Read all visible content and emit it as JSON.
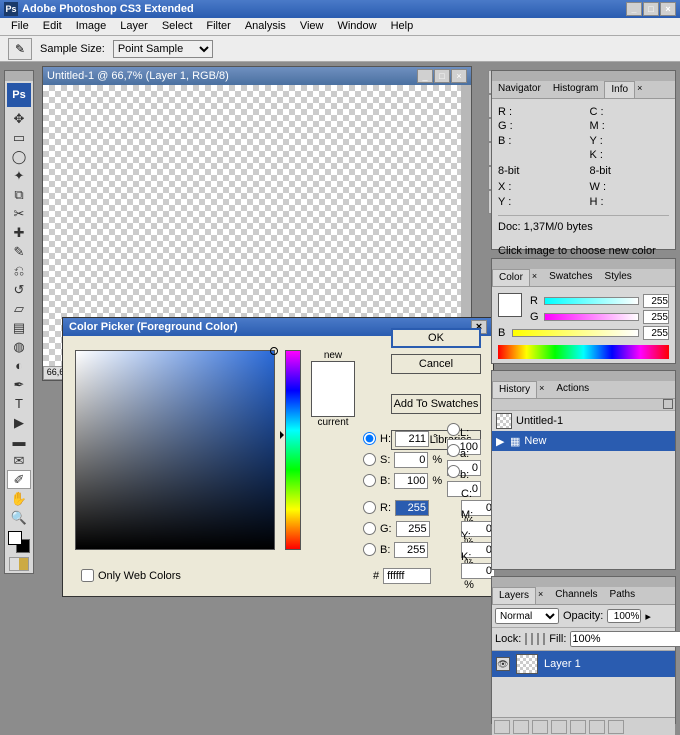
{
  "app": {
    "title": "Adobe Photoshop CS3 Extended"
  },
  "menu": [
    "File",
    "Edit",
    "Image",
    "Layer",
    "Select",
    "Filter",
    "Analysis",
    "View",
    "Window",
    "Help"
  ],
  "optbar": {
    "label": "Sample Size:",
    "value": "Point Sample"
  },
  "doc": {
    "title": "Untitled-1 @ 66,7% (Layer 1, RGB/8)",
    "zoom": "66,67"
  },
  "cp": {
    "title": "Color Picker (Foreground Color)",
    "new": "new",
    "current": "current",
    "btns": {
      "ok": "OK",
      "cancel": "Cancel",
      "add": "Add To Swatches",
      "libs": "Color Libraries"
    },
    "H": "211",
    "S": "0",
    "Bv": "100",
    "L": "100",
    "a": "0",
    "b": "0",
    "R": "255",
    "G": "255",
    "Bb": "255",
    "C": "0",
    "M": "0",
    "Y": "0",
    "K": "0",
    "owc": "Only Web Colors",
    "hex": "ffffff",
    "deg": "°",
    "pct": "%",
    "hash": "#"
  },
  "info": {
    "tabs": [
      "Navigator",
      "Histogram",
      "Info"
    ],
    "r": "R :",
    "g": "G :",
    "b": "B :",
    "c": "C :",
    "m": "M :",
    "y": "Y :",
    "k": "K :",
    "bit": "8-bit",
    "x": "X :",
    "yc": "Y :",
    "w": "W :",
    "h": "H :",
    "docsize": "Doc: 1,37M/0 bytes",
    "hint": "Click image to choose new color"
  },
  "color": {
    "tabs": [
      "Color",
      "Swatches",
      "Styles"
    ],
    "R": "R",
    "G": "G",
    "B": "B",
    "v": "255"
  },
  "hist": {
    "tabs": [
      "History",
      "Actions"
    ],
    "doc": "Untitled-1",
    "new": "New"
  },
  "layers": {
    "tabs": [
      "Layers",
      "Channels",
      "Paths"
    ],
    "mode": "Normal",
    "opLbl": "Opacity:",
    "op": "100%",
    "lock": "Lock:",
    "fillLbl": "Fill:",
    "fill": "100%",
    "layer": "Layer 1"
  }
}
